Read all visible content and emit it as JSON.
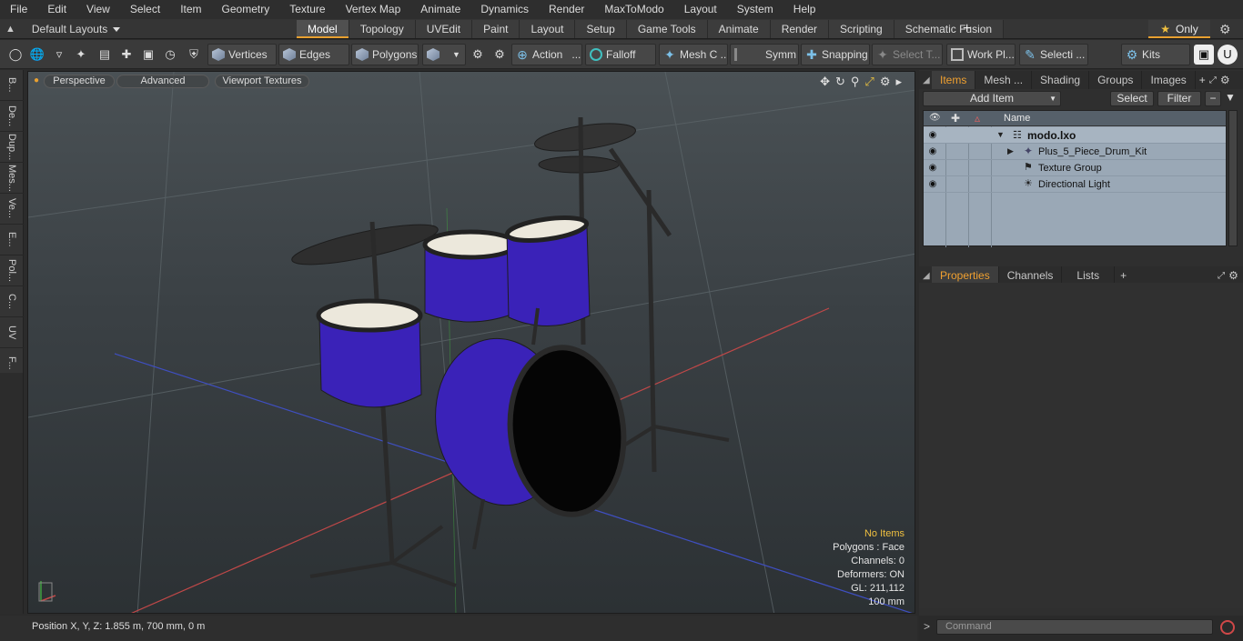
{
  "menu": [
    "File",
    "Edit",
    "View",
    "Select",
    "Item",
    "Geometry",
    "Texture",
    "Vertex Map",
    "Animate",
    "Dynamics",
    "Render",
    "MaxToModo",
    "Layout",
    "System",
    "Help"
  ],
  "layouts": {
    "label": "Default Layouts"
  },
  "tabs": [
    "Model",
    "Topology",
    "UVEdit",
    "Paint",
    "Layout",
    "Setup",
    "Game Tools",
    "Animate",
    "Render",
    "Scripting",
    "Schematic Fusion"
  ],
  "active_tab": "Model",
  "only_label": "Only",
  "toolbar": {
    "vertices": "Vertices",
    "edges": "Edges",
    "polygons": "Polygons",
    "action": "Action",
    "falloff": "Falloff",
    "mesh": "Mesh C ...",
    "symm": "Symm ...",
    "snapping": "Snapping",
    "select_t": "Select T...",
    "work_plane": "Work Pl...",
    "selection": "Selecti ...",
    "kits": "Kits"
  },
  "left_tabs": [
    "B...",
    "De...",
    "Dup...",
    "Mes...",
    "Ve...",
    "E...",
    "Pol...",
    "C...",
    "UV",
    "F..."
  ],
  "viewport": {
    "buttons": {
      "perspective": "Perspective",
      "advanced": "Advanced",
      "textures": "Viewport Textures"
    },
    "info": {
      "no_items": "No Items",
      "polygons": "Polygons : Face",
      "channels": "Channels: 0",
      "deformers": "Deformers: ON",
      "gl": "GL: 211,112",
      "scale": "100 mm"
    },
    "colors": {
      "drum_shell": "#3a22b8",
      "drum_head": "#ece8dc",
      "hardware": "#2a2a2a",
      "grid_red": "#c04848",
      "grid_blue": "#3f4fc0",
      "grid_green": "#40a040"
    }
  },
  "status": {
    "position": "Position X, Y, Z:   1.855 m, 700 mm, 0 m"
  },
  "right": {
    "top_tabs": [
      "Items",
      "Mesh ...",
      "Shading",
      "Groups",
      "Images"
    ],
    "add_item": "Add Item",
    "select": "Select",
    "filter": "Filter",
    "col_name": "Name",
    "tree": [
      {
        "label": "modo.lxo",
        "indent": 0
      },
      {
        "label": "Plus_5_Piece_Drum_Kit",
        "indent": 1
      },
      {
        "label": "Texture Group",
        "indent": 1
      },
      {
        "label": "Directional Light",
        "indent": 1
      }
    ],
    "bottom_tabs": [
      "Properties",
      "Channels",
      "Lists"
    ],
    "command_placeholder": "Command"
  }
}
